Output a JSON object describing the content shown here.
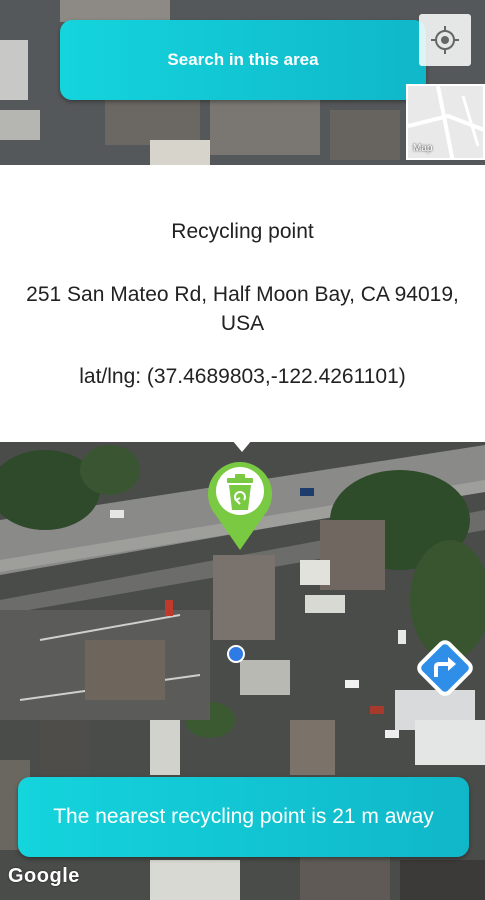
{
  "search": {
    "label": "Search in this area"
  },
  "map_type": {
    "label": "Map"
  },
  "info_window": {
    "title": "Recycling point",
    "address": "251 San Mateo Rd, Half Moon Bay, CA 94019, USA",
    "latlng": "lat/lng: (37.4689803,-122.4261101)"
  },
  "nearest": {
    "text": "The nearest recycling point is 21 m away"
  },
  "attribution": {
    "text": "Google"
  },
  "icons": {
    "locate": "crosshair-icon",
    "marker": "recycling-bin-icon",
    "directions": "turn-right-arrow-icon"
  },
  "colors": {
    "accent": "#12c6d4",
    "marker": "#7ac943",
    "directions": "#2f8fe8",
    "user_location": "#2f7be6"
  }
}
